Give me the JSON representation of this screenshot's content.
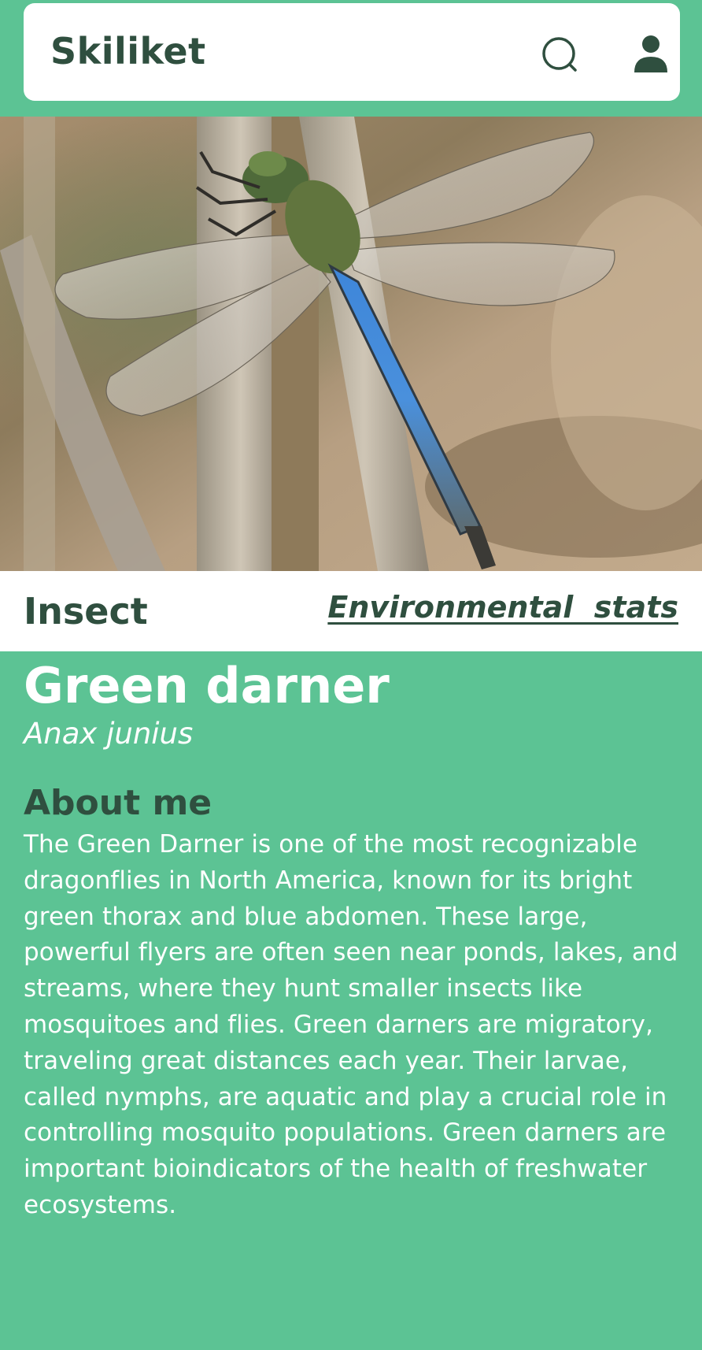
{
  "header": {
    "app_title": "Skiliket",
    "search_icon": "search-icon",
    "user_icon": "user-icon"
  },
  "photo": {
    "subject": "dragonfly-photo"
  },
  "category_bar": {
    "category": "Insect",
    "env_link": "Environmental  stats"
  },
  "species": {
    "common_name": "Green darner",
    "scientific_name": "Anax junius"
  },
  "about": {
    "heading": "About me",
    "text": "The Green Darner is one of the most recognizable dragonflies in North America, known for its bright green thorax and blue abdomen. These large, powerful flyers are often seen near ponds, lakes, and streams, where they hunt smaller insects like mosquitoes and flies. Green darners are migratory, traveling great distances each year. Their larvae, called nymphs, are aquatic and play a crucial role in controlling mosquito populations. Green darners are important bioindicators of the health of freshwater ecosystems."
  },
  "colors": {
    "background": "#5cc394",
    "text_dark": "#2f4f3f",
    "white": "#ffffff"
  }
}
